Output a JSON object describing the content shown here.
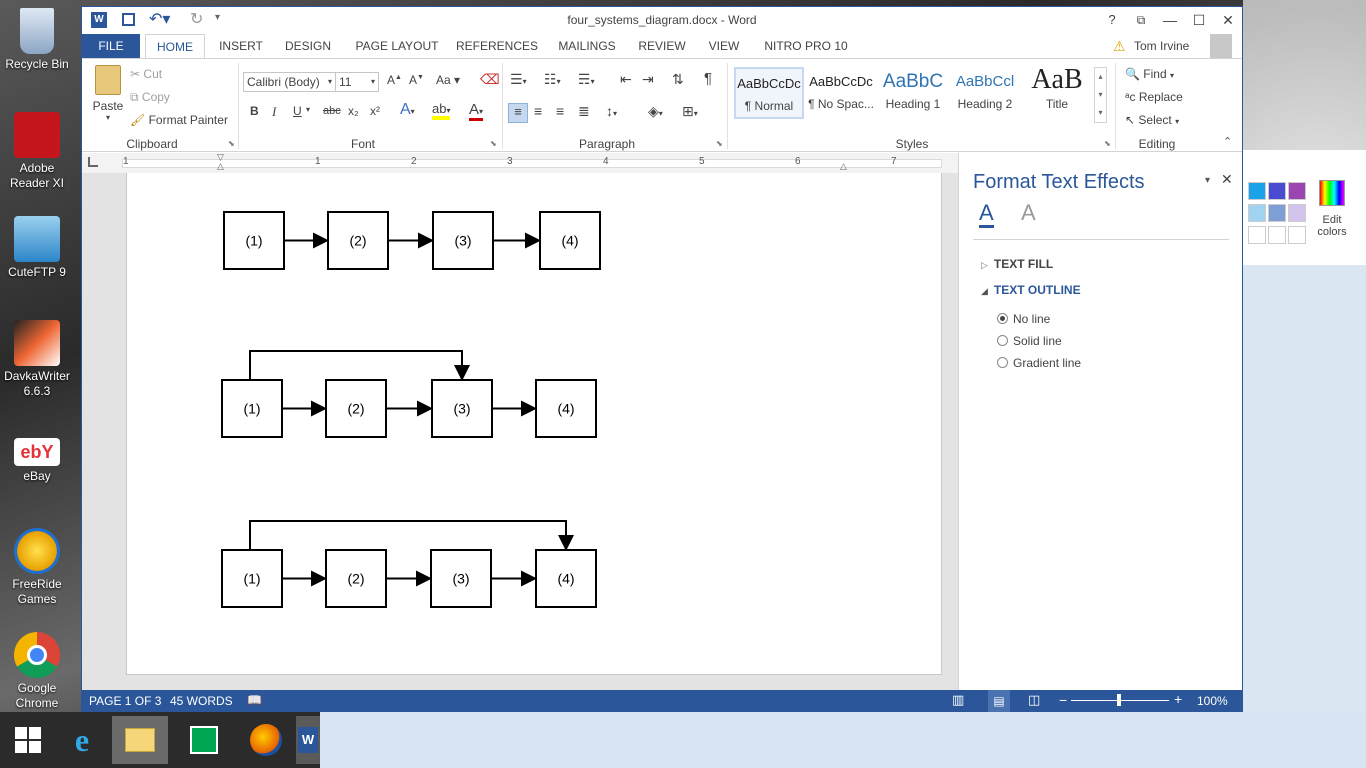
{
  "window": {
    "title": "four_systems_diagram.docx - Word",
    "help": "?",
    "user": "Tom Irvine"
  },
  "tabs": [
    "FILE",
    "HOME",
    "INSERT",
    "DESIGN",
    "PAGE LAYOUT",
    "REFERENCES",
    "MAILINGS",
    "REVIEW",
    "VIEW",
    "NITRO PRO 10"
  ],
  "clipboard": {
    "paste": "Paste",
    "cut": "Cut",
    "copy": "Copy",
    "format_painter": "Format Painter",
    "label": "Clipboard"
  },
  "font": {
    "name": "Calibri (Body)",
    "size": "11",
    "label": "Font",
    "bold": "B",
    "italic": "I",
    "underline": "U",
    "strike": "abc",
    "sub": "x₂",
    "sup": "x²",
    "case": "Aa"
  },
  "paragraph": {
    "label": "Paragraph",
    "pilcrow": "¶"
  },
  "styles": {
    "label": "Styles",
    "items": [
      {
        "preview": "AaBbCcDc",
        "name": "¶ Normal"
      },
      {
        "preview": "AaBbCcDc",
        "name": "¶ No Spac..."
      },
      {
        "preview": "AaBbC",
        "name": "Heading 1"
      },
      {
        "preview": "AaBbCcl",
        "name": "Heading 2"
      },
      {
        "preview": "AaB",
        "name": "Title"
      }
    ]
  },
  "editing": {
    "find": "Find",
    "replace": "Replace",
    "select": "Select",
    "label": "Editing"
  },
  "ruler": [
    "1",
    "1",
    "2",
    "3",
    "4",
    "5",
    "6",
    "7"
  ],
  "diagram": {
    "rows": [
      {
        "boxes": [
          "(1)",
          "(2)",
          "(3)",
          "(4)"
        ]
      },
      {
        "boxes": [
          "(1)",
          "(2)",
          "(3)",
          "(4)"
        ]
      },
      {
        "boxes": [
          "(1)",
          "(2)",
          "(3)",
          "(4)"
        ]
      }
    ]
  },
  "pane": {
    "title": "Format Text Effects",
    "text_fill": "TEXT FILL",
    "text_outline": "TEXT OUTLINE",
    "options": [
      "No line",
      "Solid line",
      "Gradient line"
    ],
    "selected": "No line"
  },
  "status": {
    "page": "PAGE 1 OF 3",
    "words": "45 WORDS",
    "zoom": "100%"
  },
  "desktop_icons": [
    {
      "label": "Recycle Bin"
    },
    {
      "label": "Adobe Reader XI"
    },
    {
      "label": "CuteFTP 9"
    },
    {
      "label": "DavkaWriter 6.6.3"
    },
    {
      "label": "eBay"
    },
    {
      "label": "FreeRide Games"
    },
    {
      "label": "Google Chrome"
    }
  ],
  "peek": {
    "edit_colors": "Edit colors"
  },
  "colors": {
    "word_blue": "#2b579a",
    "taskbar": "#d8e4f2"
  }
}
